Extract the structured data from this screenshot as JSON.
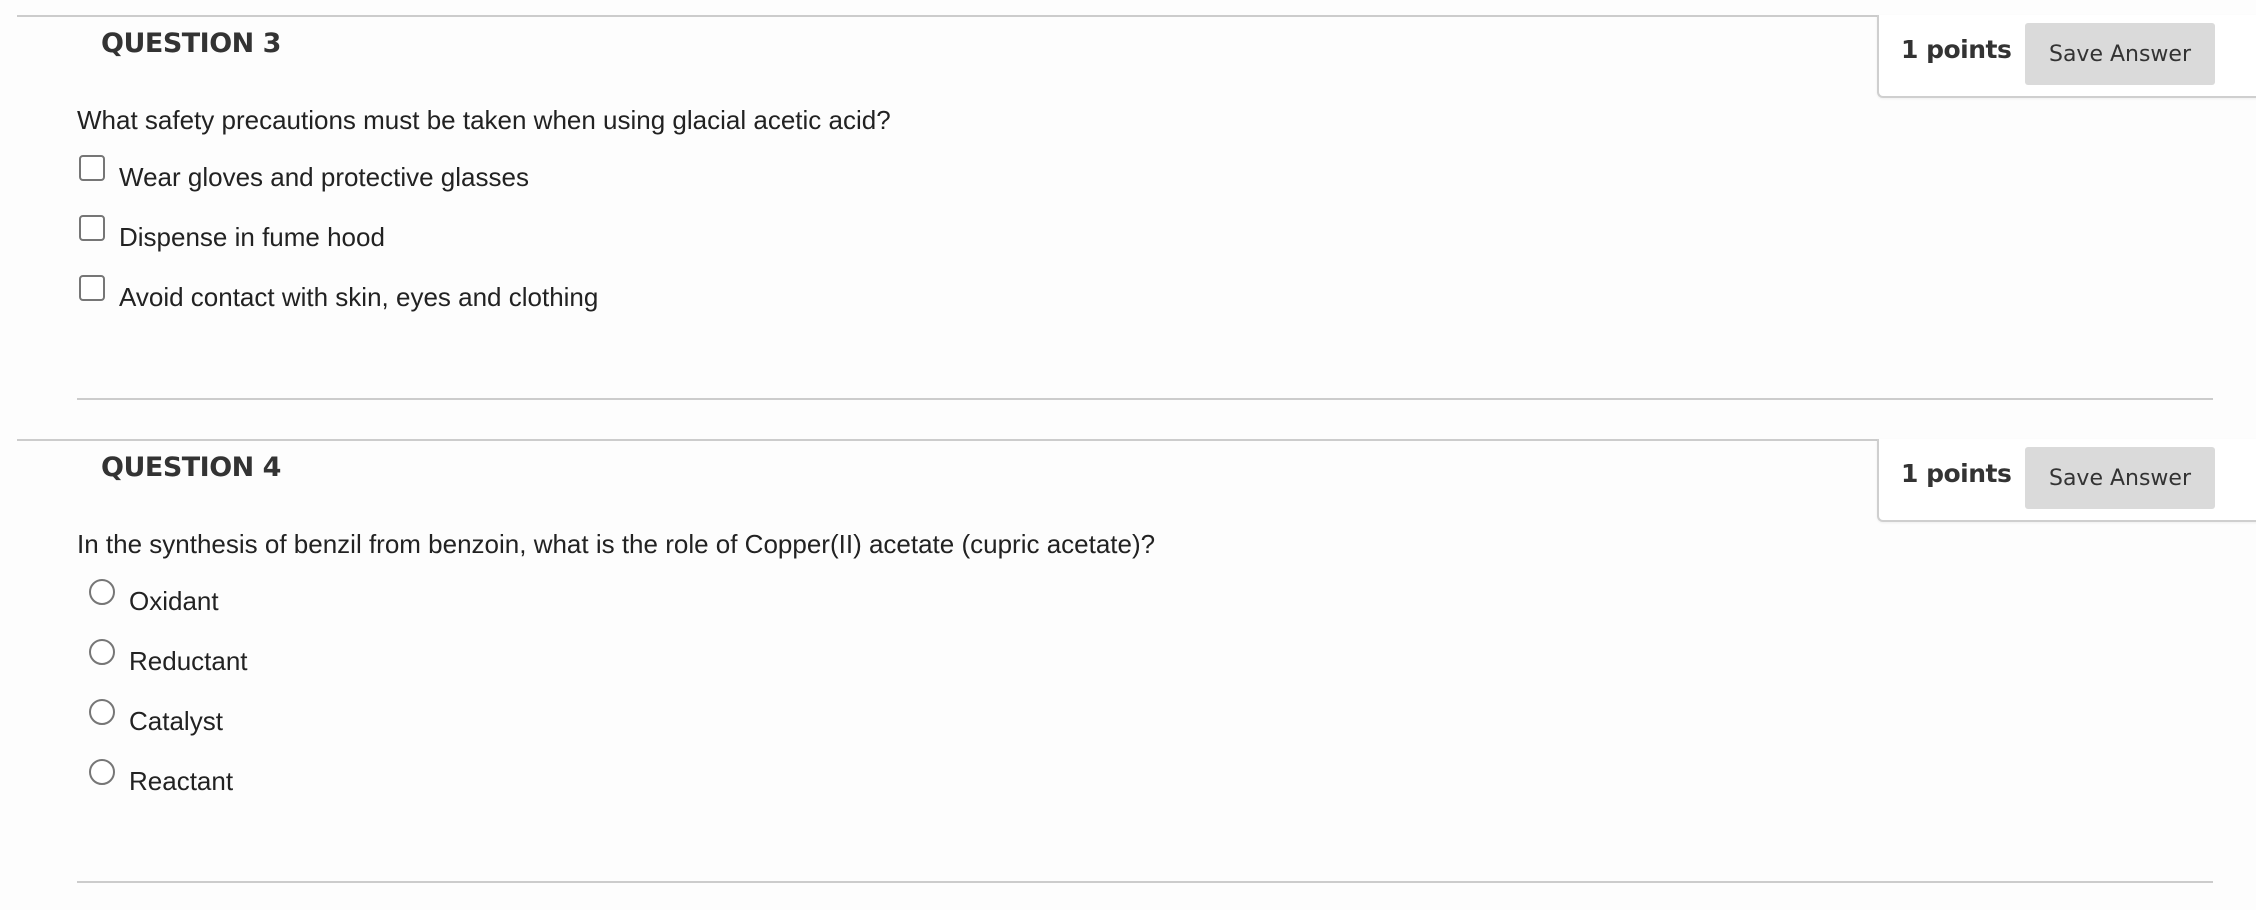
{
  "questions": [
    {
      "title": "QUESTION 3",
      "points": "1 points",
      "save_label": "Save Answer",
      "text": "What safety precautions must be taken when using glacial acetic acid?",
      "input_type": "checkbox",
      "options": [
        {
          "label": "Wear gloves and protective glasses",
          "checked": false
        },
        {
          "label": "Dispense in fume hood",
          "checked": false
        },
        {
          "label": "Avoid contact with skin, eyes and clothing",
          "checked": false
        }
      ]
    },
    {
      "title": "QUESTION 4",
      "points": "1 points",
      "save_label": "Save Answer",
      "text": "In the synthesis of benzil from benzoin, what is the role of Copper(II) acetate (cupric acetate)?",
      "input_type": "radio",
      "options": [
        {
          "label": "Oxidant",
          "checked": false
        },
        {
          "label": "Reductant",
          "checked": false
        },
        {
          "label": "Catalyst",
          "checked": false
        },
        {
          "label": "Reactant",
          "checked": false
        }
      ]
    }
  ]
}
